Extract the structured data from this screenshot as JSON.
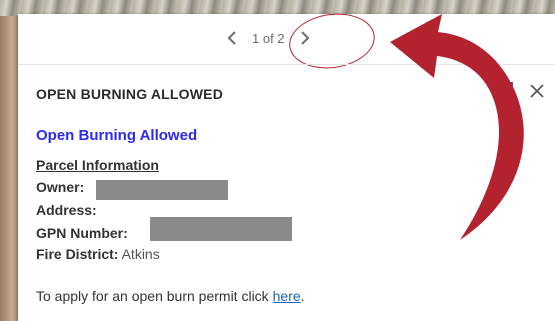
{
  "pager": {
    "count_text": "1 of 2"
  },
  "popup": {
    "title": "OPEN BURNING ALLOWED"
  },
  "content": {
    "subtitle": "Open Burning Allowed",
    "section_heading": "Parcel Information",
    "owner_label": "Owner:",
    "address_label": "Address:",
    "gpn_label": "GPN Number:",
    "fire_label": "Fire District:",
    "fire_value": "Atkins",
    "apply_text": "To apply for an open burn permit click ",
    "apply_link": "here",
    "apply_end": "."
  },
  "icons": {
    "prev": "chevron-left-icon",
    "next": "chevron-right-icon",
    "close": "close-icon",
    "dock": "dock-icon",
    "annotation": "curved-arrow-icon"
  },
  "colors": {
    "subtitle": "#2a2af0",
    "link": "#1b62c4",
    "annotation": "#b3232f",
    "redaction": "#8a8a8a"
  }
}
